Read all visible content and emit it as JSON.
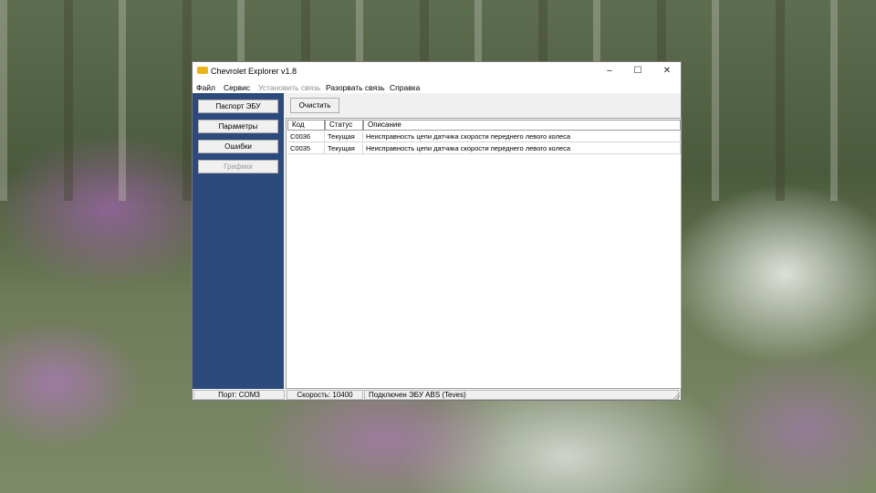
{
  "window": {
    "title": "Chevrolet Explorer v1.8",
    "minimize": "–",
    "maximize": "☐",
    "close": "✕"
  },
  "menu": {
    "file": "Файл",
    "service": "Сервис",
    "connect": "Установить связь",
    "disconnect": "Разорвать связь",
    "help": "Справка"
  },
  "sidebar": {
    "ecu_passport": "Паспорт ЭБУ",
    "parameters": "Параметры",
    "errors": "Ошибки",
    "graphs": "Графики"
  },
  "toolbar": {
    "clear": "Очистить"
  },
  "table": {
    "headers": {
      "code": "Код",
      "status": "Статус",
      "description": "Описание"
    },
    "rows": [
      {
        "code": "C0036",
        "status": "Текущая",
        "description": "Неисправность цепи датчика скорости переднего левого колеса"
      },
      {
        "code": "C0035",
        "status": "Текущая",
        "description": "Неисправность цепи датчика скорости переднего левого колеса"
      }
    ]
  },
  "statusbar": {
    "port": "Порт: COM3",
    "speed": "Скорость: 10400",
    "connection": "Подключен ЭБУ ABS (Teves)"
  },
  "colors": {
    "sidebar": "#2c4b7c",
    "app_icon": "#e8b417"
  }
}
